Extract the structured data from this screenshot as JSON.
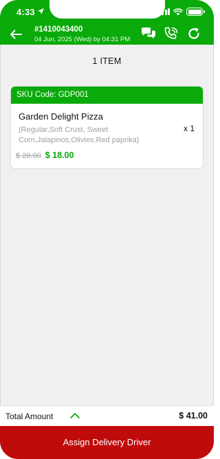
{
  "status_bar": {
    "time": "4:33"
  },
  "header": {
    "order_id": "#1410043400",
    "order_date": "04 Jun, 2025 (Wed) by 04:31 PM"
  },
  "item_count_label": "1 ITEM",
  "items": [
    {
      "sku": "SKU Code: GDP001",
      "name": "Garden Delight Pizza",
      "options": "(Regular,Soft Crust, Sweet Corn,Jalapinos,Olivies,Red paprika)",
      "quantity": "x 1",
      "original_price": "$ 20.00",
      "price": "$ 18.00"
    }
  ],
  "footer": {
    "total_label": "Total Amount",
    "total_value": "$ 41.00",
    "assign_button_label": "Assign Delivery Driver"
  },
  "colors": {
    "brand_green": "#0aaa0a",
    "action_red": "#c00b0b",
    "background": "#f0f0f0"
  },
  "icons": [
    "location-arrow-icon",
    "signal-icon",
    "wifi-icon",
    "battery-icon",
    "back-arrow-icon",
    "chat-icon",
    "phone-call-icon",
    "refresh-icon",
    "chevron-up-icon"
  ]
}
